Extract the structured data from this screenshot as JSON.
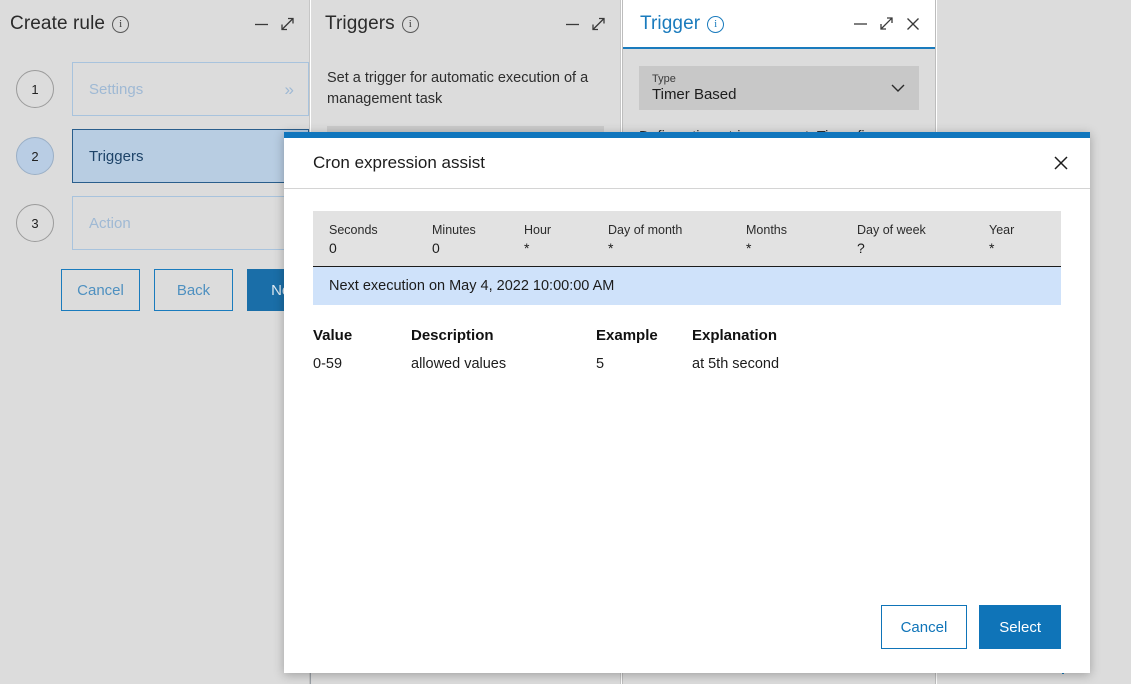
{
  "colors": {
    "accent": "#1a7bbd",
    "modal_accent": "#0f74b8",
    "panel_bg": "#dcdcdc",
    "step_active_bg": "#b8cde2",
    "highlight_row": "#cfe2fa"
  },
  "panels": {
    "create_rule": {
      "title": "Create rule",
      "icons": {
        "info": "info-icon",
        "minimize": "minimize-icon",
        "expand": "expand-icon"
      },
      "steps": [
        {
          "number": "1",
          "label": "Settings",
          "active": false
        },
        {
          "number": "2",
          "label": "Triggers",
          "active": true
        },
        {
          "number": "3",
          "label": "Action",
          "active": false
        }
      ],
      "buttons": {
        "cancel": "Cancel",
        "back": "Back",
        "next": "Next"
      }
    },
    "triggers": {
      "title": "Triggers",
      "description": "Set a trigger for automatic execution of a management task"
    },
    "trigger": {
      "title": "Trigger",
      "type_label": "Type",
      "type_value": "Timer Based",
      "description": "Defines timer trigger event. Timer fires"
    }
  },
  "modal": {
    "title": "Cron expression assist",
    "close_icon": "close-icon",
    "cron_fields": [
      {
        "label": "Seconds",
        "value": "0"
      },
      {
        "label": "Minutes",
        "value": "0"
      },
      {
        "label": "Hour",
        "value": "*"
      },
      {
        "label": "Day of month",
        "value": "*"
      },
      {
        "label": "Months",
        "value": "*"
      },
      {
        "label": "Day of week",
        "value": "?"
      },
      {
        "label": "Year",
        "value": "*"
      }
    ],
    "next_execution": "Next execution on May 4, 2022 10:00:00 AM",
    "legend": {
      "headers": [
        "Value",
        "Description",
        "Example",
        "Explanation"
      ],
      "rows": [
        [
          "0-59",
          "allowed values",
          "5",
          "at 5th second"
        ]
      ]
    },
    "buttons": {
      "cancel": "Cancel",
      "select": "Select"
    }
  }
}
